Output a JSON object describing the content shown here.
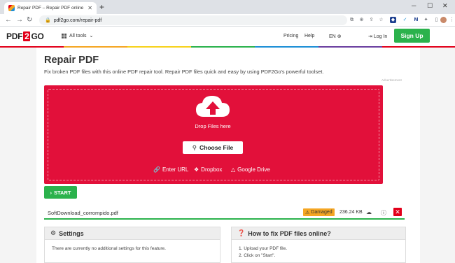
{
  "browser": {
    "tab_title": "Repair PDF – Repair PDF online",
    "new_tab": "+",
    "url": "pdf2go.com/repair-pdf"
  },
  "site": {
    "logo_left": "PDF",
    "logo_mid": "2",
    "logo_right": "GO",
    "all_tools": "All tools",
    "pricing": "Pricing",
    "help": "Help",
    "lang": "EN",
    "login": "Log In",
    "signup": "Sign Up"
  },
  "main": {
    "title": "Repair PDF",
    "subtitle": "Fix broken PDF files with this online PDF repair tool. Repair PDF files quick and easy by using PDF2Go's powerful toolset.",
    "advertisement": "Advertisement",
    "drop_text": "Drop Files here",
    "choose_file": "Choose File",
    "enter_url": "Enter URL",
    "dropbox": "Dropbox",
    "google_drive": "Google Drive",
    "start": "START"
  },
  "file": {
    "name": "SoftDownload_corrompido.pdf",
    "status": "Damaged",
    "size": "236.24 KB"
  },
  "settings": {
    "title": "Settings",
    "body": "There are currently no additional settings for this feature."
  },
  "howto": {
    "title": "How to fix PDF files online?",
    "steps": [
      "1. Upload your PDF file.",
      "2. Click on \"Start\"."
    ]
  },
  "colors": {
    "brand_red": "#e2103a",
    "green": "#2bb24c",
    "damaged_badge": "#f5a623"
  }
}
